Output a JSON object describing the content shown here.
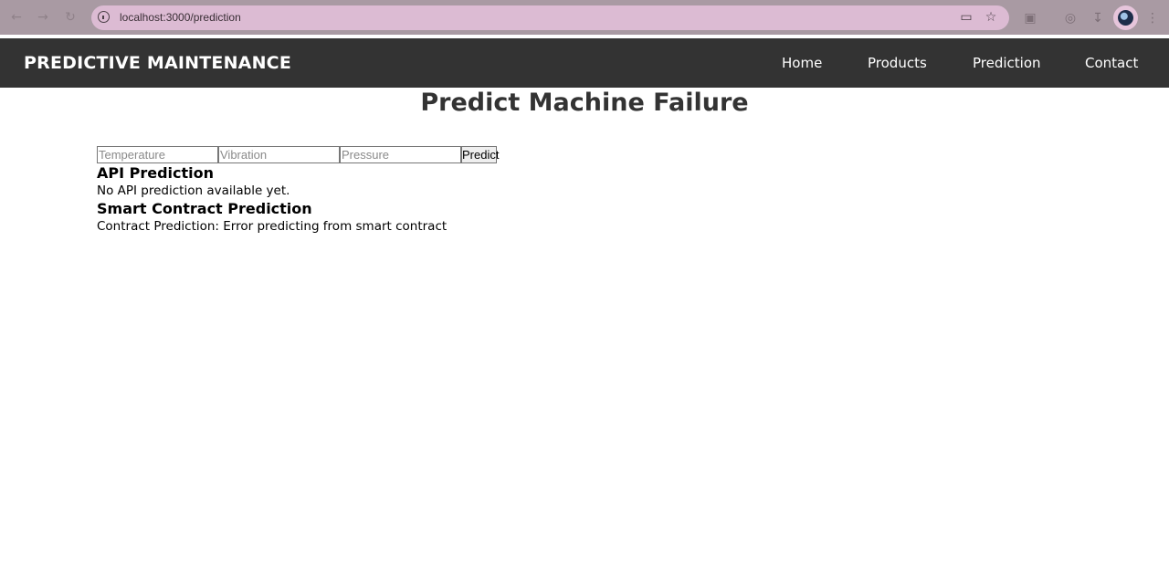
{
  "browser": {
    "url": "localhost:3000/prediction",
    "icons": {
      "back": "arrow-left-icon",
      "forward": "arrow-right-icon",
      "reload": "reload-icon",
      "site_info": "info-icon",
      "install": "install-app-icon",
      "bookmark": "star-icon",
      "extensions": "puzzle-icon",
      "media": "media-icon",
      "downloads": "download-icon",
      "profile": "avatar"
    }
  },
  "navbar": {
    "brand": "PREDICTIVE MAINTENANCE",
    "links": [
      "Home",
      "Products",
      "Prediction",
      "Contact"
    ]
  },
  "main": {
    "title": "Predict Machine Failure",
    "form": {
      "temperature_placeholder": "Temperature",
      "vibration_placeholder": "Vibration",
      "pressure_placeholder": "Pressure",
      "submit_label": "Predict"
    },
    "api_section": {
      "heading": "API Prediction",
      "text": "No API prediction available yet."
    },
    "contract_section": {
      "heading": "Smart Contract Prediction",
      "text": "Contract Prediction: Error predicting from smart contract"
    }
  },
  "colors": {
    "chrome": "#a99aa3",
    "omnibox": "#dcbbd3",
    "navbar": "#333333",
    "title": "#333333"
  }
}
